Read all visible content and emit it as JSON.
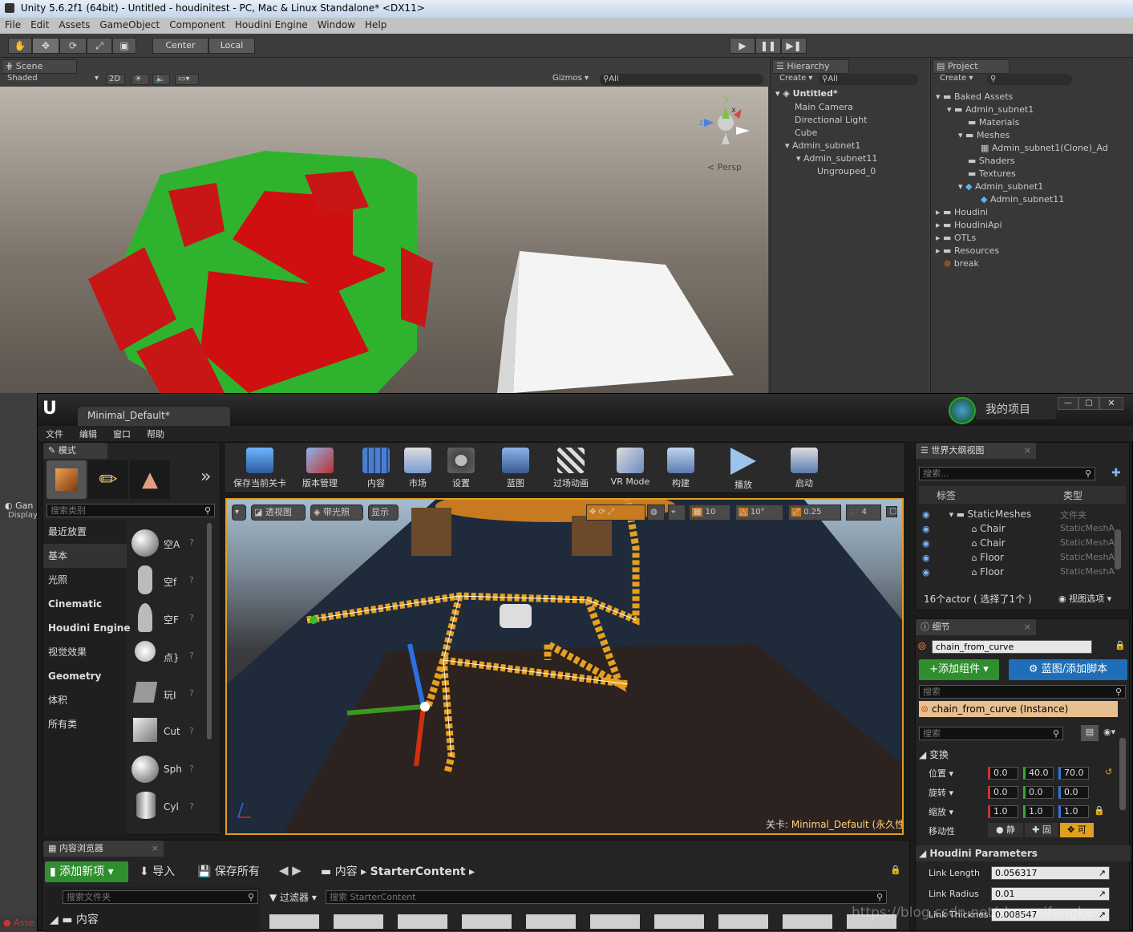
{
  "window": {
    "title": "Unity 5.6.2f1 (64bit) - Untitled - houdinitest - PC, Mac & Linux Standalone* <DX11>"
  },
  "menu": [
    "File",
    "Edit",
    "Assets",
    "GameObject",
    "Component",
    "Houdini Engine",
    "Window",
    "Help"
  ],
  "toolbar": {
    "center": "Center",
    "local": "Local"
  },
  "scene": {
    "tab": "Scene",
    "shaded": "Shaded",
    "mode2d": "2D",
    "gizmos": "Gizmos",
    "search": "All",
    "persp": "Persp",
    "gizmo_y": "y",
    "gizmo_x": "x",
    "gizmo_z": "z"
  },
  "hierarchy": {
    "tab": "Hierarchy",
    "create": "Create",
    "search": "All",
    "root": "Untitled*",
    "items": [
      "Main Camera",
      "Directional Light",
      "Cube",
      "Admin_subnet1",
      "Admin_subnet11",
      "Ungrouped_0"
    ]
  },
  "project": {
    "tab": "Project",
    "create": "Create",
    "items": [
      "Baked Assets",
      "Admin_subnet1",
      "Materials",
      "Meshes",
      "Admin_subnet1(Clone)_Ad",
      "Shaders",
      "Textures",
      "Admin_subnet1",
      "Admin_subnet11",
      "Houdini",
      "HoudiniApi",
      "OTLs",
      "Resources",
      "break"
    ]
  },
  "game": {
    "tab": "Gan",
    "display": "Display"
  },
  "assets_label": "Asse",
  "ue": {
    "level_tab": "Minimal_Default*",
    "project_name": "我的项目",
    "menu": [
      "文件",
      "编辑",
      "窗口",
      "帮助"
    ],
    "modes": {
      "tab": "模式",
      "search": "搜索类别",
      "categories": [
        "最近放置",
        "基本",
        "光照",
        "Cinematic",
        "Houdini Engine",
        "视觉效果",
        "Geometry",
        "体积",
        "所有类"
      ],
      "actors": [
        "空A",
        "空f",
        "空F",
        "点}",
        "玩I",
        "Cut",
        "Sph",
        "Cyl"
      ]
    },
    "toolbar": [
      "保存当前关卡",
      "版本管理",
      "内容",
      "市场",
      "设置",
      "蓝图",
      "过场动画",
      "VR Mode",
      "构建",
      "播放",
      "启动"
    ],
    "viewport": {
      "persp": "透视图",
      "lit": "带光照",
      "show": "显示",
      "grid": "10",
      "angle": "10°",
      "scale": "0.25",
      "cam": "4",
      "level_label": "关卡:",
      "level_name": "Minimal_Default (永久性)"
    },
    "outliner": {
      "tab": "世界大纲视图",
      "search": "搜索...",
      "col_label": "标签",
      "col_type": "类型",
      "rows": [
        {
          "name": "StaticMeshes",
          "type": "文件夹"
        },
        {
          "name": "Chair",
          "type": "StaticMeshA"
        },
        {
          "name": "Chair",
          "type": "StaticMeshA"
        },
        {
          "name": "Floor",
          "type": "StaticMeshA"
        },
        {
          "name": "Floor",
          "type": "StaticMeshA"
        }
      ],
      "count": "16个actor ( 选择了1个 )",
      "view_options": "视图选项"
    },
    "details": {
      "tab": "细节",
      "name": "chain_from_curve",
      "add_component": "+添加组件",
      "blueprint": "蓝图/添加脚本",
      "search": "搜索",
      "instance": "chain_from_curve (Instance)",
      "search2": "搜索",
      "transform": "变换",
      "location_label": "位置",
      "rotation_label": "旋转",
      "scale_label": "缩放",
      "mobility_label": "移动性",
      "location": [
        "0.0",
        "40.0",
        "70.0"
      ],
      "rotation": [
        "0.0",
        "0.0",
        "0.0"
      ],
      "scale": [
        "1.0",
        "1.0",
        "1.0"
      ],
      "mobility": [
        "静",
        "固",
        "可"
      ],
      "houdini_params": "Houdini Parameters",
      "params": [
        {
          "label": "Link Length",
          "value": "0.056317"
        },
        {
          "label": "Link Radius",
          "value": "0.01"
        },
        {
          "label": "Link Thickness",
          "value": "0.008547"
        }
      ]
    },
    "content": {
      "tab": "内容浏览器",
      "add_new": "添加新项",
      "import": "导入",
      "save_all": "保存所有",
      "crumb_root": "内容",
      "crumb_child": "StarterContent",
      "search_folder": "搜索文件夹",
      "filter": "过滤器",
      "search_content": "搜索 StarterContent",
      "tree_root": "内容"
    }
  },
  "watermark": "https://blog.csdn.net/shenmifangke",
  "colors": {
    "unity_bg": "#3e3e3e",
    "ue_bg": "#1b1b1b",
    "accent": "#e0a020",
    "green_btn": "#2f8f2f",
    "blue_btn": "#1e6fb8"
  }
}
